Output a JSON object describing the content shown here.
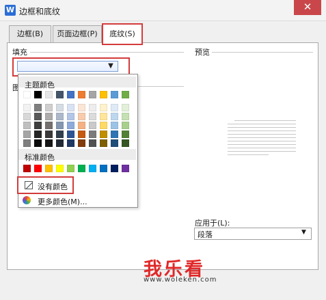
{
  "window": {
    "title": "边框和底纹",
    "app_icon": "W",
    "close_glyph": "✕"
  },
  "tabs": [
    {
      "label": "边框(B)"
    },
    {
      "label": "页面边框(P)"
    },
    {
      "label": "底纹(S)",
      "active": true
    }
  ],
  "fill": {
    "label": "填充",
    "dropdown_glyph": "▼"
  },
  "pattern": {
    "label": "图"
  },
  "preview": {
    "label": "预览"
  },
  "apply_to": {
    "label": "应用于(L):",
    "value": "段落",
    "dropdown_glyph": "▼"
  },
  "color_menu": {
    "theme_title": "主题颜色",
    "standard_title": "标准颜色",
    "no_color": "没有颜色",
    "more_colors": "更多颜色(M)...",
    "theme_top_row": [
      "#ffffff",
      "#000000",
      "#e7e6e6",
      "#44546a",
      "#4472c4",
      "#ed7d31",
      "#a5a5a5",
      "#ffc000",
      "#5b9bd5",
      "#70ad47"
    ],
    "theme_shades": [
      [
        "#f2f2f2",
        "#7f7f7f",
        "#d0cece",
        "#d6dce4",
        "#d9e2f3",
        "#fbe5d5",
        "#ededed",
        "#fff2cc",
        "#deebf6",
        "#e2efd9"
      ],
      [
        "#d8d8d8",
        "#595959",
        "#aeabab",
        "#adb9ca",
        "#b4c6e7",
        "#f7cbac",
        "#dbdbdb",
        "#fee599",
        "#bdd7ee",
        "#c5e0b3"
      ],
      [
        "#bfbfbf",
        "#3f3f3f",
        "#757070",
        "#8496b0",
        "#8eaadb",
        "#f4b183",
        "#c9c9c9",
        "#ffd965",
        "#9cc3e5",
        "#a8d08d"
      ],
      [
        "#a5a5a5",
        "#262626",
        "#3a3838",
        "#323f4f",
        "#2f5496",
        "#c55a11",
        "#7b7b7b",
        "#bf8f00",
        "#2e75b5",
        "#538135"
      ],
      [
        "#7f7f7f",
        "#0c0c0c",
        "#171616",
        "#222a35",
        "#1f3864",
        "#833c0b",
        "#525252",
        "#7f6000",
        "#1e4e79",
        "#375623"
      ]
    ],
    "standard_colors": [
      "#c00000",
      "#ff0000",
      "#ffc000",
      "#ffff00",
      "#92d050",
      "#00b050",
      "#00b0f0",
      "#0070c0",
      "#002060",
      "#7030a0"
    ]
  },
  "watermark": {
    "text": "我乐看",
    "url": "www.woleken.com"
  },
  "accent_colors": {
    "highlight_frame": "#d33b3b",
    "close_button": "#c9474a"
  }
}
